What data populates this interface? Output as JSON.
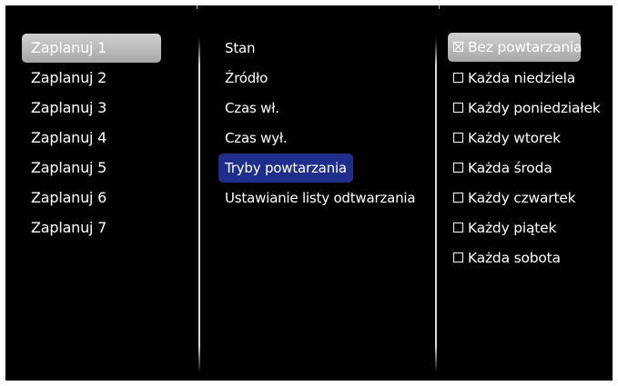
{
  "schedule_list": {
    "items": [
      {
        "label": "Zaplanuj 1",
        "selected": true
      },
      {
        "label": "Zaplanuj 2",
        "selected": false
      },
      {
        "label": "Zaplanuj 3",
        "selected": false
      },
      {
        "label": "Zaplanuj 4",
        "selected": false
      },
      {
        "label": "Zaplanuj 5",
        "selected": false
      },
      {
        "label": "Zaplanuj 6",
        "selected": false
      },
      {
        "label": "Zaplanuj 7",
        "selected": false
      }
    ]
  },
  "settings_menu": {
    "items": [
      {
        "label": "Stan",
        "selected": false
      },
      {
        "label": "Źródło",
        "selected": false
      },
      {
        "label": "Czas wł.",
        "selected": false
      },
      {
        "label": "Czas wył.",
        "selected": false
      },
      {
        "label": "Tryby powtarzania",
        "selected": true
      },
      {
        "label": "Ustawianie listy odtwarzania",
        "selected": false
      }
    ]
  },
  "repeat_modes": {
    "items": [
      {
        "label": "Bez powtarzania",
        "checked": true,
        "selected": true
      },
      {
        "label": "Każda niedziela",
        "checked": false,
        "selected": false
      },
      {
        "label": "Każdy poniedziałek",
        "checked": false,
        "selected": false
      },
      {
        "label": "Każdy wtorek",
        "checked": false,
        "selected": false
      },
      {
        "label": "Każda środa",
        "checked": false,
        "selected": false
      },
      {
        "label": "Każdy czwartek",
        "checked": false,
        "selected": false
      },
      {
        "label": "Każdy piątek",
        "checked": false,
        "selected": false
      },
      {
        "label": "Każda sobota",
        "checked": false,
        "selected": false
      }
    ]
  },
  "colors": {
    "background": "#000000",
    "selected_gray": "#bfbfbf",
    "selected_blue": "#1f2e8a",
    "text": "#ffffff"
  }
}
